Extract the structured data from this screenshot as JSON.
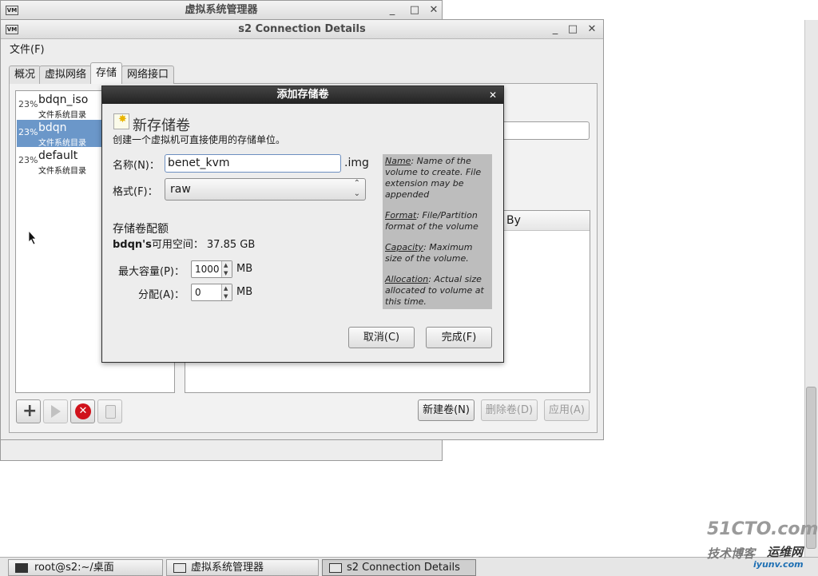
{
  "background_window": {
    "title": "虚拟系统管理器",
    "icon": "vm-icon"
  },
  "details_window": {
    "title": "s2 Connection Details",
    "menu_file": "文件(F)",
    "tabs": [
      "概况",
      "虚拟网络",
      "存储",
      "网络接口"
    ],
    "active_tab": "存储",
    "pools": [
      {
        "percent": "23%",
        "name": "bdqn_iso",
        "type": "文件系统目录"
      },
      {
        "percent": "23%",
        "name": "bdqn",
        "type": "文件系统目录",
        "selected": true
      },
      {
        "percent": "23%",
        "name": "default",
        "type": "文件系统目录"
      }
    ],
    "volumes_header_partial": "By",
    "buttons": {
      "new_volume": "新建卷(N)",
      "delete_volume": "删除卷(D)",
      "apply": "应用(A)"
    }
  },
  "dialog": {
    "title": "添加存储卷",
    "heading": "新存储卷",
    "description": "创建一个虚拟机可直接使用的存储单位。",
    "name_label": "名称(N)：",
    "name_value": "benet_kvm",
    "name_suffix": ".img",
    "format_label": "格式(F)：",
    "format_value": "raw",
    "quota_heading": "存储卷配额",
    "pool_name": "bdqn's",
    "available_label": "可用空间：",
    "available_value": "37.85 GB",
    "max_capacity_label": "最大容量(P)：",
    "max_capacity_value": "1000",
    "allocation_label": "分配(A)：",
    "allocation_value": "0",
    "unit": "MB",
    "cancel_button": "取消(C)",
    "finish_button": "完成(F)",
    "help": {
      "name_term": "Name",
      "name_text": ": Name of the volume to create. File extension may be appended",
      "format_term": "Format",
      "format_text": ": File/Partition format of the volume",
      "capacity_term": "Capacity",
      "capacity_text": ": Maximum size of the volume.",
      "allocation_term": "Allocation",
      "allocation_text": ": Actual size allocated to volume at this time."
    }
  },
  "taskbar": {
    "items": [
      "root@s2:~/桌面",
      "虚拟系统管理器",
      "s2 Connection Details"
    ]
  },
  "watermark": {
    "line1": "51CTO.com",
    "line2": "技术博客",
    "line3": "运维网",
    "line4": "iyunv.com"
  }
}
